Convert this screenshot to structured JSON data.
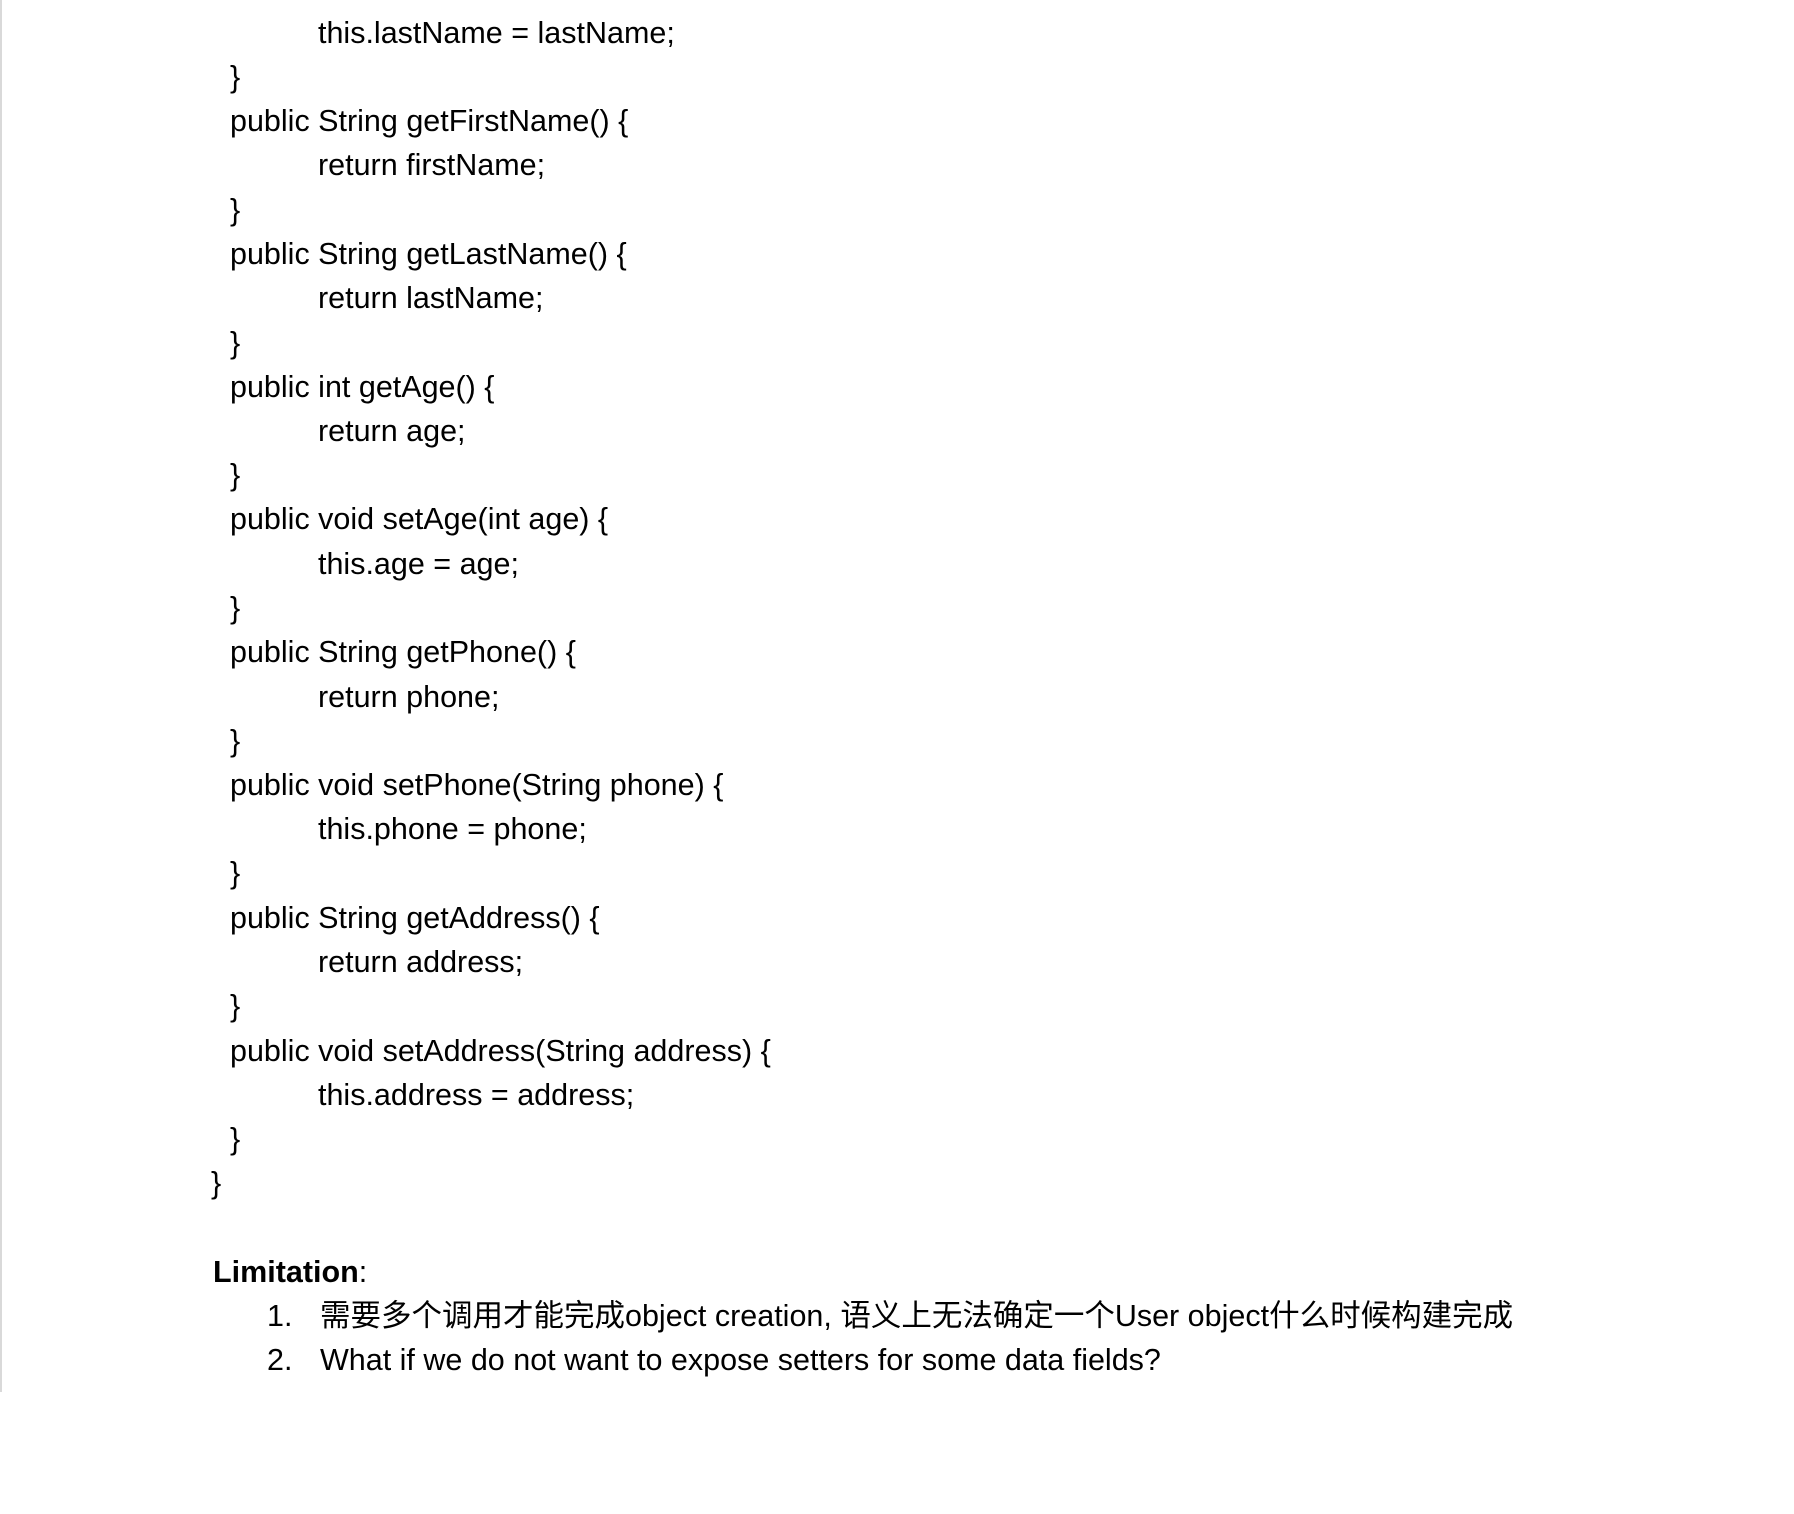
{
  "code_lines": [
    "this.lastName = lastName;",
    "}",
    "public String getFirstName() {",
    "return firstName;",
    "}",
    "public String getLastName() {",
    "return lastName;",
    "}",
    "public int getAge() {",
    "return age;",
    "}",
    "public void setAge(int age) {",
    "this.age = age;",
    "}",
    "public String getPhone() {",
    "return phone;",
    "}",
    "public void setPhone(String phone) {",
    "this.phone = phone;",
    "}",
    "public String getAddress() {",
    "return address;",
    "}",
    "public void setAddress(String address) {",
    "this.address = address;",
    "}",
    "}"
  ],
  "limitation": {
    "heading": "Limitation",
    "colon": ":",
    "items": [
      {
        "number": "1.",
        "text": "需要多个调用才能完成object creation, 语义上无法确定一个User object什么时候构建完成"
      },
      {
        "number": "2.",
        "text": "What if we do not want to expose setters for some data fields?"
      }
    ]
  }
}
